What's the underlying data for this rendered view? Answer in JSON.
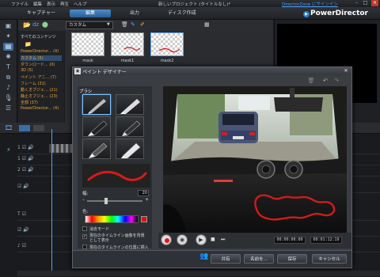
{
  "window": {
    "menu": [
      "ファイル",
      "編集",
      "表示",
      "再生",
      "ヘルプ"
    ],
    "title": "新しいプロジェクト (タイトルなし)*",
    "directorzone_link": "DirectorZone にサインイン",
    "brand": "PowerDirector"
  },
  "modes": {
    "capture": "キャプチャー",
    "edit": "編集",
    "produce": "出力",
    "disc": "ディスク作成"
  },
  "library": {
    "dropdown": "カスタム",
    "tree": [
      {
        "label": "すべてのコンテンツ",
        "color": "white"
      },
      {
        "label": "PowerDirector...   (4)",
        "color": "orange"
      },
      {
        "label": "カスタム   (5)",
        "color": "orange"
      },
      {
        "label": "ダウンロード...  (0)",
        "color": "orange"
      },
      {
        "label": "3D   (5)",
        "color": "orange"
      },
      {
        "label": "ペイント アニ...   (7)",
        "color": "orange"
      },
      {
        "label": "フレーム  (31)",
        "color": "orange"
      },
      {
        "label": "動くオブジェ...  (21)",
        "color": "orange"
      },
      {
        "label": "静止オブジェ...  (23)",
        "color": "orange"
      },
      {
        "label": "全部  (37)",
        "color": "orange"
      },
      {
        "label": "PowerDirector...   (4)",
        "color": "orange"
      }
    ],
    "thumbnails": [
      "mask",
      "mask1",
      "mask2"
    ]
  },
  "paint_designer": {
    "title": "ペイント デザイナー",
    "brush_label": "ブラシ",
    "size_label": "幅:",
    "size_value": "20",
    "color_label": "色:",
    "checkboxes": [
      {
        "label": "消去モード",
        "checked": false
      },
      {
        "label": "現在のタイムライン画像を背景として表示",
        "checked": true
      },
      {
        "label": "現在のタイムラインの位置に挿入",
        "checked": false
      }
    ],
    "timecode_current": "00:00:00:00",
    "timecode_total": "00:01:12:19",
    "buttons": {
      "share": "共有",
      "save_as": "名前を...",
      "save": "保存",
      "cancel": "キャンセル"
    }
  }
}
